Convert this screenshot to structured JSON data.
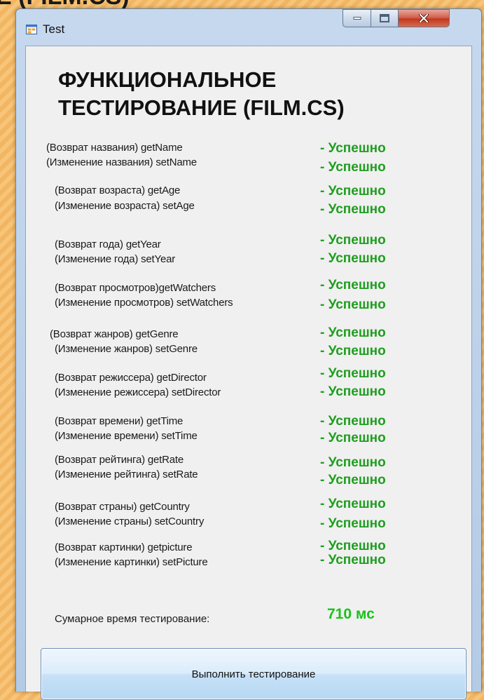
{
  "background_title_fragment": "Е (FILM.CS)",
  "window": {
    "title": "Test",
    "icon": "windows-form-icon",
    "controls": {
      "minimize_icon": "minimize-icon",
      "maximize_icon": "maximize-icon",
      "close_icon": "close-icon"
    }
  },
  "heading": {
    "line1": "ФУНКЦИОНАЛЬНОЕ",
    "line2": "ТЕСТИРОВАНИЕ (FILM.CS)"
  },
  "tests": [
    {
      "label": "(Возврат названия) getName",
      "status": "- Успешно"
    },
    {
      "label": "(Изменение названия) setName",
      "status": "- Успешно"
    },
    {
      "label": "(Возврат возраста) getAge",
      "status": "- Успешно"
    },
    {
      "label": "(Изменение возраста) setAge",
      "status": "- Успешно"
    },
    {
      "label": "(Возврат года) getYear",
      "status": "- Успешно"
    },
    {
      "label": "(Изменение года) setYear",
      "status": "- Успешно"
    },
    {
      "label": "(Возврат просмотров)getWatchers",
      "status": "- Успешно"
    },
    {
      "label": "(Изменение просмотров) setWatchers",
      "status": "- Успешно"
    },
    {
      "label": "(Возврат жанров) getGenre",
      "status": "- Успешно"
    },
    {
      "label": "(Изменение жанров) setGenre",
      "status": "- Успешно"
    },
    {
      "label": "(Возврат режиссера) getDirector",
      "status": "- Успешно"
    },
    {
      "label": "(Изменение режиссера) setDirector",
      "status": "- Успешно"
    },
    {
      "label": "(Возврат времени) getTime",
      "status": "- Успешно"
    },
    {
      "label": "(Изменение времени) setTime",
      "status": "- Успешно"
    },
    {
      "label": "(Возврат рейтинга) getRate",
      "status": "- Успешно"
    },
    {
      "label": "(Изменение рейтинга) setRate",
      "status": "- Успешно"
    },
    {
      "label": "(Возврат страны) getCountry",
      "status": "- Успешно"
    },
    {
      "label": "(Изменение страны) setCountry",
      "status": "- Успешно"
    },
    {
      "label": "(Возврат картинки) getpicture",
      "status": "- Успешно"
    },
    {
      "label": "(Изменение картинки) setPicture",
      "status": "- Успешно"
    }
  ],
  "total": {
    "label": "Сумарное время тестирование:",
    "value": "710 мс"
  },
  "run_button_label": "Выполнить тестирование",
  "colors": {
    "success": "#1e9e1e",
    "total_value": "#19c219",
    "slide_background": "#f2b561",
    "window_frame": "#c6d8ee",
    "client_background": "#f0f0f0"
  }
}
